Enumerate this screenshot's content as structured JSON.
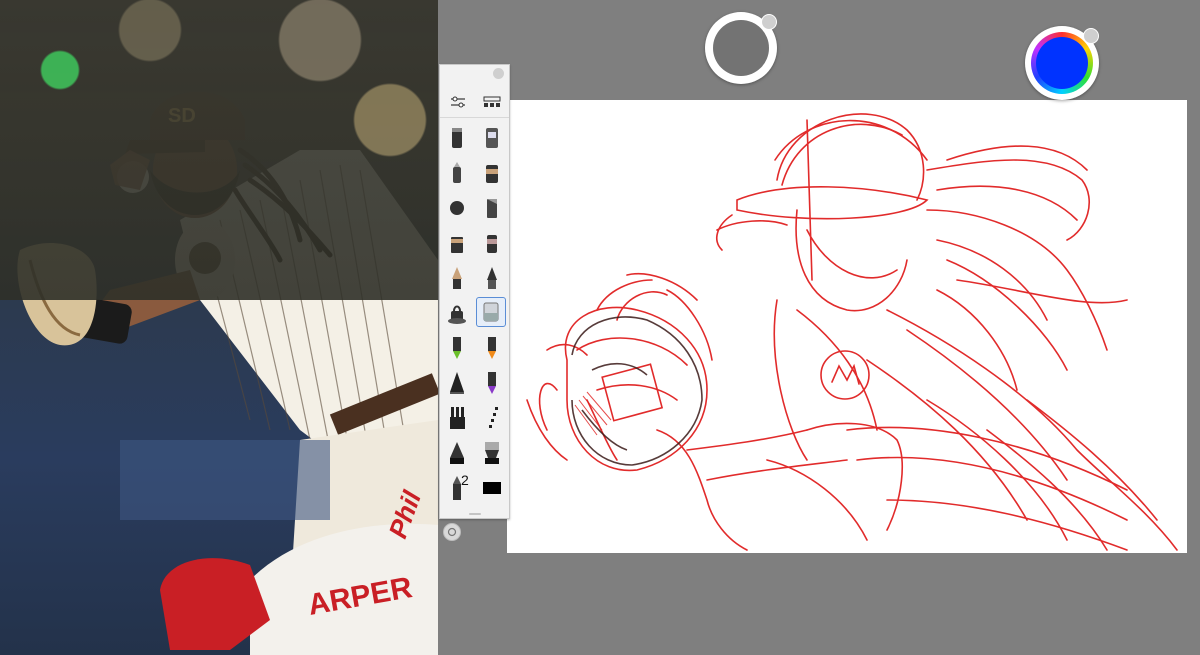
{
  "photo": {
    "cap_logo": "SD",
    "jersey_name": "ARPER",
    "jersey_team": "Phil"
  },
  "palette": {
    "slot_number": "2",
    "tabs": [
      "sliders-icon",
      "brush-library-icon"
    ],
    "tools": [
      "pencil-icon",
      "pencil-hard-icon",
      "marker-icon",
      "felt-pen-icon",
      "airbrush-icon",
      "chisel-icon",
      "paintbrush-icon",
      "smudge-icon",
      "calligraphy-pen-icon",
      "ink-pen-icon",
      "bucket-icon",
      "eraser-icon",
      "green-marker-icon",
      "orange-marker-icon",
      "cone-brush-icon",
      "purple-marker-icon",
      "fan-brush-icon",
      "dotted-brush-icon",
      "texture-brush-icon",
      "wide-brush-icon",
      "fine-pencil-icon",
      "black-swatch-icon"
    ]
  },
  "colors": {
    "current_color": "#0033ff",
    "brush_gray": "#737373",
    "sketch_red": "#e02020"
  }
}
